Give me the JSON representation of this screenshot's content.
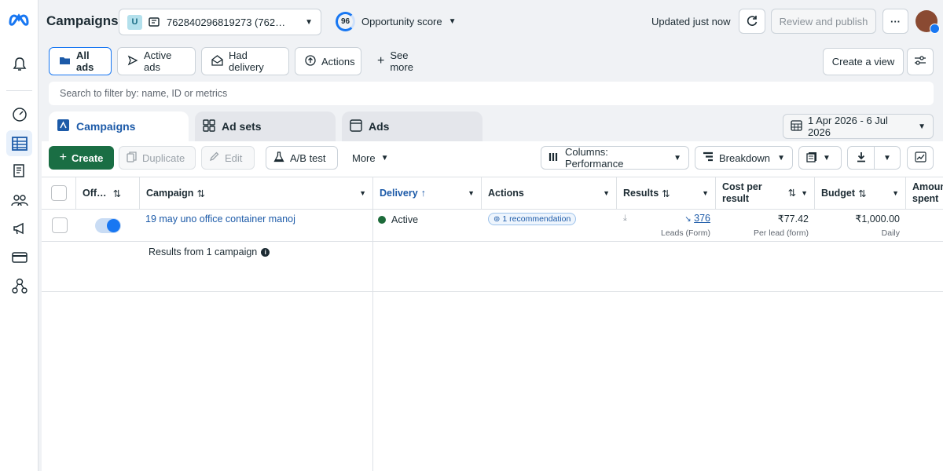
{
  "header": {
    "title": "Campaigns",
    "account_initial": "U",
    "account_id": "762840296819273 (762…",
    "opportunity_score": "96",
    "opportunity_label": "Opportunity score",
    "updated_text": "Updated just now",
    "review_publish": "Review and publish",
    "more_dots": "···"
  },
  "filters": {
    "all_ads": "All ads",
    "active_ads": "Active ads",
    "had_delivery": "Had delivery",
    "actions": "Actions",
    "see_more": "See more",
    "create_view": "Create a view"
  },
  "search": {
    "placeholder": "Search to filter by: name, ID or metrics"
  },
  "level_tabs": {
    "campaigns": "Campaigns",
    "ad_sets": "Ad sets",
    "ads": "Ads"
  },
  "date_range": "1 Apr 2026 - 6 Jul 2026",
  "toolbar": {
    "create": "Create",
    "duplicate": "Duplicate",
    "edit": "Edit",
    "ab_test": "A/B test",
    "more": "More",
    "columns": "Columns: Performance",
    "breakdown": "Breakdown"
  },
  "columns": {
    "off_on": "Off…",
    "campaign": "Campaign",
    "delivery": "Delivery",
    "actions": "Actions",
    "results": "Results",
    "cost_per_result_1": "Cost per",
    "cost_per_result_2": "result",
    "budget": "Budget",
    "amount_spent_1": "Amoun",
    "amount_spent_2": "spent"
  },
  "row": {
    "name": "19 may uno office container manoj",
    "delivery": "Active",
    "recommendation": "1 recommendation",
    "results_value": "376",
    "results_sub": "Leads (Form)",
    "cost_value": "₹77.42",
    "cost_sub": "Per lead (form)",
    "budget_value": "₹1,000.00",
    "budget_sub": "Daily"
  },
  "summary": {
    "text": "Results from 1 campaign"
  },
  "colors": {
    "accent": "#1877f2",
    "create_green": "#1a6e44",
    "active_green": "#1d6b3a"
  }
}
